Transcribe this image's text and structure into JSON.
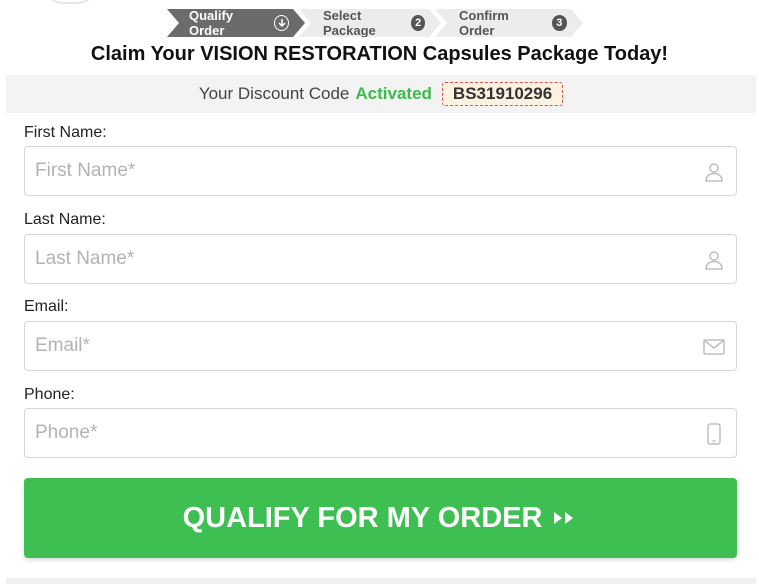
{
  "steps": [
    {
      "label": "Qualify Order",
      "marker": "down-arrow-circle",
      "active": true
    },
    {
      "label": "Select Package",
      "number": "2",
      "active": false
    },
    {
      "label": "Confirm Order",
      "number": "3",
      "active": false
    }
  ],
  "headline": "Claim Your VISION RESTORATION Capsules Package Today!",
  "discount": {
    "prefix": "Your Discount Code",
    "status": "Activated",
    "code": "BS31910296",
    "status_color": "#3dba4e"
  },
  "form": {
    "first_name": {
      "label": "First Name:",
      "placeholder": "First Name*",
      "value": "",
      "icon": "user-icon"
    },
    "last_name": {
      "label": "Last Name:",
      "placeholder": "Last Name*",
      "value": "",
      "icon": "user-icon"
    },
    "email": {
      "label": "Email:",
      "placeholder": "Email*",
      "value": "",
      "icon": "envelope-icon"
    },
    "phone": {
      "label": "Phone:",
      "placeholder": "Phone*",
      "value": "",
      "icon": "mobile-phone-icon"
    }
  },
  "submit": {
    "label": "QUALIFY FOR MY ORDER",
    "icon": "double-play-icon",
    "color": "#3dbf52"
  }
}
